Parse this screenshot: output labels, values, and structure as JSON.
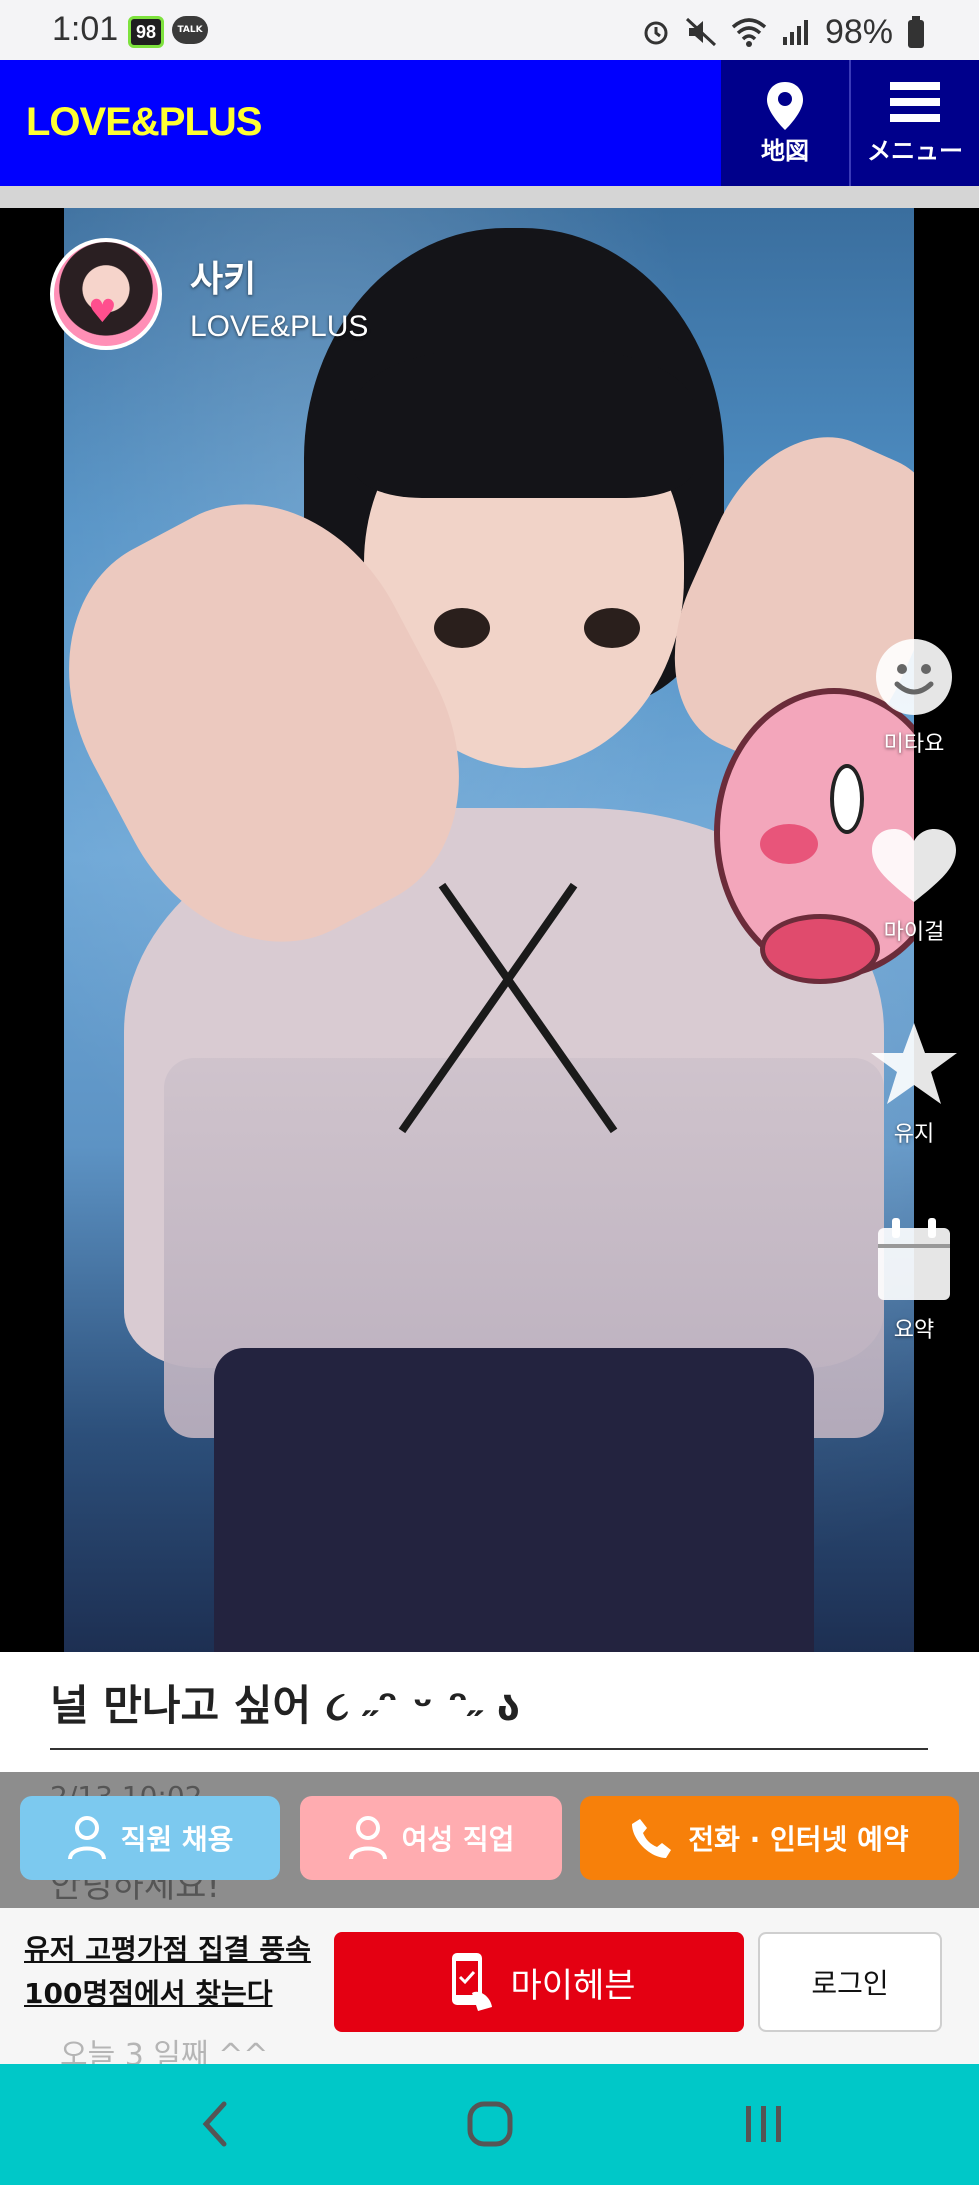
{
  "status_bar": {
    "time": "1:01",
    "notif_badge": "98",
    "talk_label": "TALK",
    "battery": "98%"
  },
  "header": {
    "logo": "LOVE&PLUS",
    "map_label": "地図",
    "menu_label": "メニュー",
    "brand_color": "#0000ff",
    "logo_color": "#ffff33"
  },
  "profile": {
    "name": "사키",
    "shop": "LOVE&PLUS"
  },
  "side_actions": [
    {
      "label": "미타요",
      "icon": "smiley-icon"
    },
    {
      "label": "마이걸",
      "icon": "heart-icon"
    },
    {
      "label": "유지",
      "icon": "star-icon"
    },
    {
      "label": "요약",
      "icon": "calendar-icon"
    }
  ],
  "post": {
    "title": "널 만나고 싶어 ૮ ˶ᵔ ᵕ ᵔ˶ ა",
    "date_partial": "2/13 10:02",
    "body_partial": "안녕하세요!"
  },
  "action_buttons": {
    "staff": "직원 채용",
    "women": "여성 직업",
    "reserve": "전화 · 인터넷 예약",
    "colors": {
      "staff": "#7cc9ef",
      "women": "#ffacb0",
      "reserve": "#f7800a"
    }
  },
  "banner": {
    "text": "유저 고평가점 집결 풍속 100명점에서 찾는다",
    "myheaven": "마이헤븐",
    "login": "로그인",
    "peek": "오늘 3 일째 ^^"
  },
  "navbar": {
    "back": "back-icon",
    "home": "home-icon",
    "recents": "recents-icon"
  }
}
